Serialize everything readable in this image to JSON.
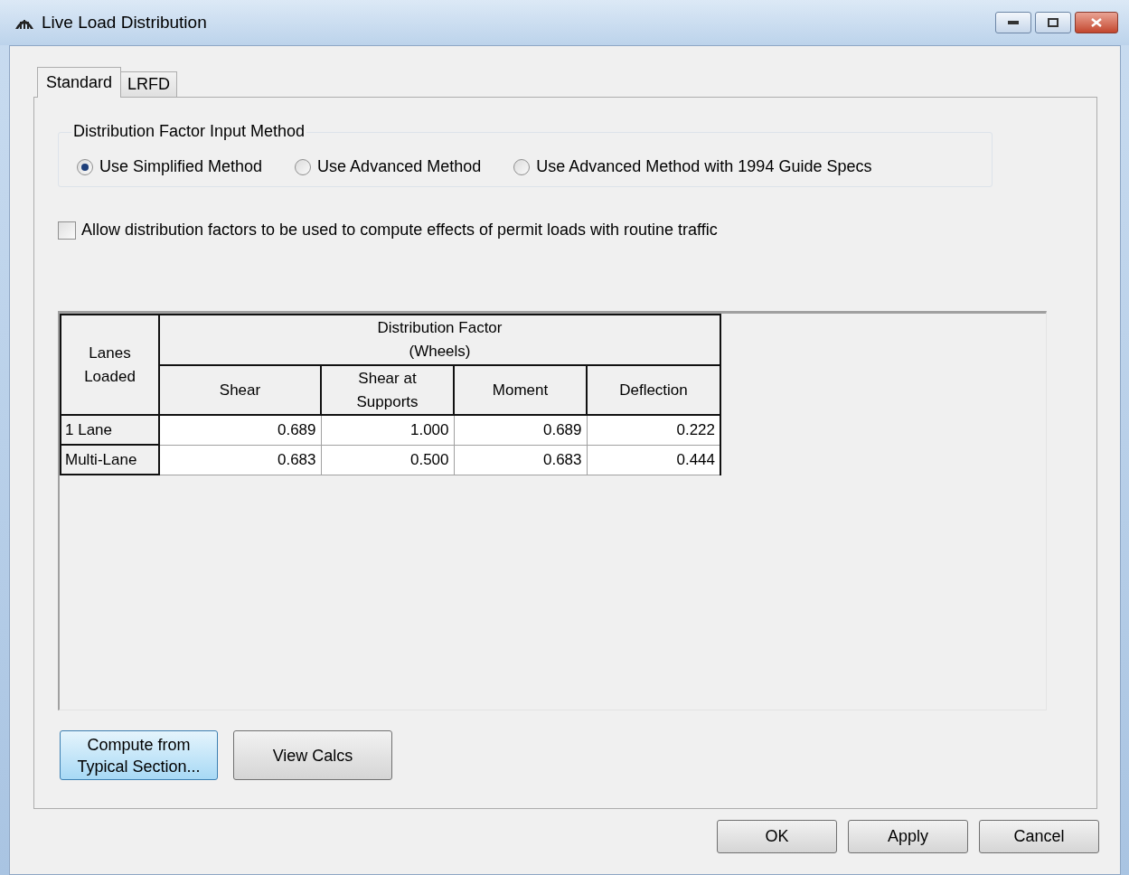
{
  "window": {
    "title": "Live Load Distribution"
  },
  "tabs": [
    {
      "label": "Standard",
      "selected": true
    },
    {
      "label": "LRFD",
      "selected": false
    }
  ],
  "input_method": {
    "title": "Distribution Factor Input Method",
    "options": [
      {
        "label": "Use Simplified Method",
        "selected": true
      },
      {
        "label": "Use Advanced Method",
        "selected": false
      },
      {
        "label": "Use Advanced Method with 1994 Guide Specs",
        "selected": false
      }
    ]
  },
  "permit_checkbox": {
    "label": "Allow distribution factors to be used to compute effects of permit loads with routine traffic",
    "checked": false
  },
  "table": {
    "row_header": "Lanes\nLoaded",
    "group_header": "Distribution Factor\n(Wheels)",
    "columns": [
      "Shear",
      "Shear at\nSupports",
      "Moment",
      "Deflection"
    ],
    "rows": [
      {
        "label": "1 Lane",
        "values": [
          "0.689",
          "1.000",
          "0.689",
          "0.222"
        ]
      },
      {
        "label": "Multi-Lane",
        "values": [
          "0.683",
          "0.500",
          "0.683",
          "0.444"
        ]
      }
    ]
  },
  "actions": [
    {
      "label": "Compute from\nTypical Section...",
      "focused": true
    },
    {
      "label": "View Calcs",
      "focused": false
    }
  ],
  "footer_buttons": [
    "OK",
    "Apply",
    "Cancel"
  ]
}
